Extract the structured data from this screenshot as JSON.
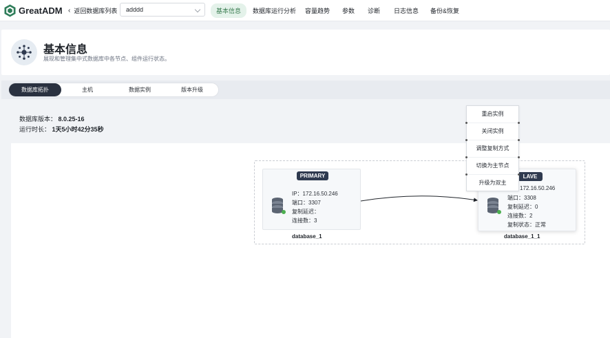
{
  "app": {
    "brand": "GreatADM"
  },
  "topbar": {
    "back_label": "返回数据库列表",
    "db_select_value": "adddd",
    "tabs": [
      {
        "label": "基本信息",
        "active": true
      },
      {
        "label": "数据库运行分析"
      },
      {
        "label": "容量趋势"
      },
      {
        "label": "参数"
      },
      {
        "label": "诊断"
      },
      {
        "label": "日志信息"
      },
      {
        "label": "备份&恢复"
      }
    ]
  },
  "header": {
    "title": "基本信息",
    "description": "展现和管理集中式数据库中各节点、组件运行状态。"
  },
  "subtabs": [
    {
      "label": "数据库拓扑",
      "active": true
    },
    {
      "label": "主机"
    },
    {
      "label": "数据实例"
    },
    {
      "label": "版本升级"
    }
  ],
  "info": {
    "version_label": "数据库版本：",
    "version_value": "8.0.25-16",
    "uptime_label": "运行时长：",
    "uptime_value": "1天5小时42分35秒"
  },
  "nodes": {
    "primary": {
      "role": "PRIMARY",
      "ip": "IP：172.16.50.246",
      "port": "端口：3307",
      "delay": "复制延迟：",
      "connections": "连接数：3",
      "name": "database_1",
      "status_color": "#4caf50"
    },
    "slave": {
      "role": "LAVE",
      "ip": "172.16.50.246",
      "port": "端口：3308",
      "delay": "复制延迟：0",
      "connections": "连接数：2",
      "repl_status": "复制状态：正常",
      "name": "database_1_1",
      "status_color": "#4caf50"
    }
  },
  "context_menu": {
    "items": [
      "重启实例",
      "关闭实例",
      "调整复制方式",
      "切换为主节点",
      "升级为双主"
    ]
  },
  "colors": {
    "accent_green": "#3b7d52",
    "dark_tab": "#2a3140",
    "badge": "#2f3a4f"
  }
}
